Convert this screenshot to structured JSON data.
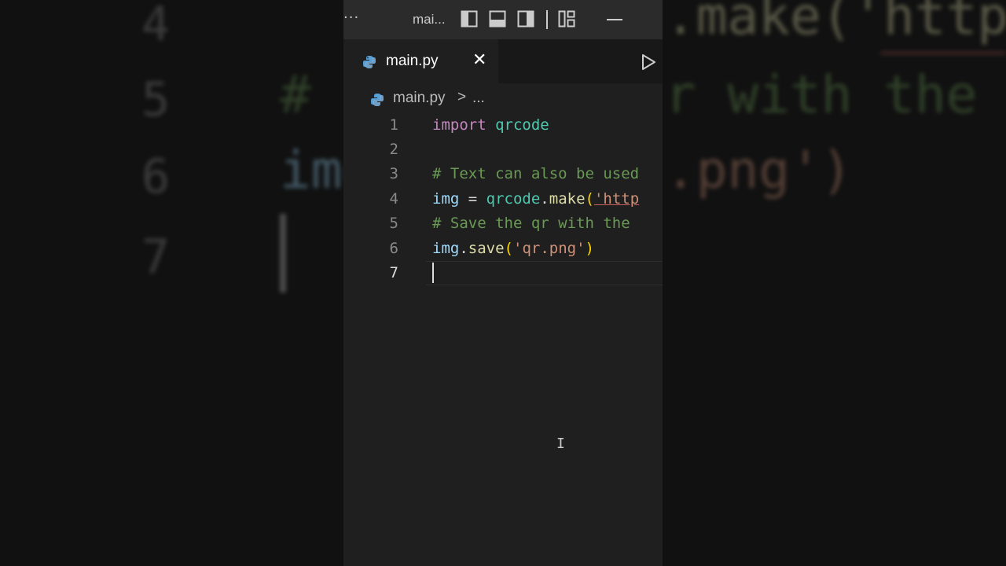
{
  "background": {
    "line_numbers": [
      "4",
      "5",
      "6",
      "7"
    ],
    "code_fragments": [
      ".make('http",
      "# ",
      "r with the",
      "img",
      ".png')"
    ]
  },
  "titlebar": {
    "more_label": "···",
    "title": "mai..."
  },
  "tab": {
    "label": "main.py",
    "close": "✕"
  },
  "breadcrumb": {
    "file": "main.py",
    "separator": ">",
    "more": "..."
  },
  "editor": {
    "line_numbers": [
      "1",
      "2",
      "3",
      "4",
      "5",
      "6",
      "7"
    ],
    "active_line": "7",
    "lines": {
      "l1": {
        "keyword": "import",
        "module": "qrcode"
      },
      "l3": {
        "comment": "# Text can also be used"
      },
      "l4": {
        "var": "img",
        "op": " = ",
        "module": "qrcode",
        "dot": ".",
        "func": "make",
        "open": "(",
        "str": "'http"
      },
      "l5": {
        "comment": "# Save the qr with the"
      },
      "l6": {
        "var": "img",
        "dot": ".",
        "func": "save",
        "open": "(",
        "str": "'qr.png'",
        "close": ")"
      }
    }
  },
  "colors": {
    "editor_bg": "#1f1f1f",
    "titlebar_bg": "#2b2b2b",
    "keyword": "#c586c0",
    "variable": "#9cdcfe",
    "module": "#4ec9b0",
    "function": "#dcdcaa",
    "string": "#ce9178",
    "comment": "#6a9955"
  },
  "icons": [
    "python-file-icon",
    "close-icon",
    "run-icon",
    "toggle-primary-sidebar-icon",
    "toggle-panel-icon",
    "toggle-secondary-sidebar-icon",
    "customize-layout-icon",
    "minimize-icon",
    "text-cursor-icon"
  ]
}
